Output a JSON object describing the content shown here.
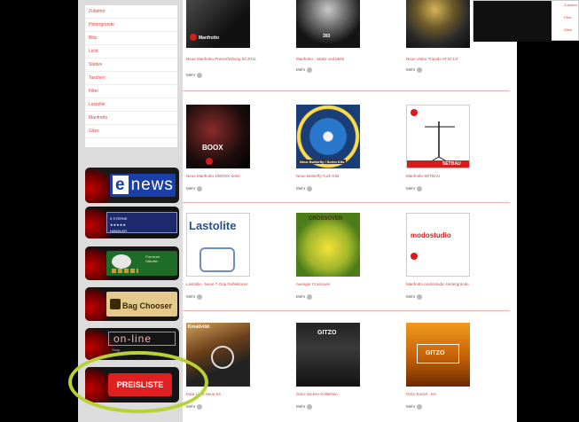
{
  "sidebar": {
    "menu": [
      "Zubehör",
      "Hintergründe",
      "Blitz",
      "Licht",
      "Stative",
      "Taschen",
      "Filter",
      "Lastolite",
      "Manfrotto",
      "Gitzo"
    ],
    "banners": {
      "news": {
        "e": "e",
        "news": "news"
      },
      "haendler": {
        "line1": "5 STERNE",
        "line2": "★★★★★",
        "line3": "HÄNDLER"
      },
      "eco": {
        "line1": "Premium",
        "line2": "Händler"
      },
      "bag": {
        "label": "Bag Chooser"
      },
      "online": {
        "label": "on-line",
        "sub": "Shop"
      },
      "preis": {
        "label": "PREISLISTE"
      }
    }
  },
  "products": [
    {
      "title": "Neue Manfrotto Preiserhöhung 02.2011",
      "more": "Mehr",
      "thumb_text": "Manfrotto"
    },
    {
      "title": "Manfrotto - Stativ und Mehr",
      "more": "Mehr",
      "thumb_text": "393"
    },
    {
      "title": "Neue Video Tripods AT M 1/4",
      "more": "Mehr",
      "thumb_text": ""
    },
    {
      "title": "Neue Manfrotto 1/BOOX Serie",
      "more": "Mehr",
      "thumb_text": "BOOX"
    },
    {
      "title": "Neue Butterfly Tuch Kits",
      "more": "Mehr",
      "thumb_text": "Neue Butterfly / Scrim Kits"
    },
    {
      "title": "Manfrotto SETBAU",
      "more": "Mehr",
      "thumb_text": "SETBAU"
    },
    {
      "title": "Lastolite - Neue T-Grip Reflektoren",
      "more": "Mehr",
      "thumb_text": "Lastolite"
    },
    {
      "title": "Avenger Crossover",
      "more": "Mehr",
      "thumb_text": "CROSSOVER"
    },
    {
      "title": "Manfrotto modostudio Hintergründe",
      "more": "Mehr",
      "thumb_text": "modostudio"
    },
    {
      "title": "Kata Light Neue Kit",
      "more": "Mehr",
      "thumb_text": "Kreativität"
    },
    {
      "title": "Gitzo Jacken Kollektion",
      "more": "Mehr",
      "thumb_text": "GITZO"
    },
    {
      "title": "Gitzo Einzel - ein",
      "more": "Mehr",
      "thumb_text": "GITZO"
    }
  ],
  "popup": {
    "links": [
      "Zubehör",
      "Filter",
      "Gitzo"
    ]
  },
  "colors": {
    "accent": "#e04040",
    "highlight_ring": "#b8d236"
  }
}
